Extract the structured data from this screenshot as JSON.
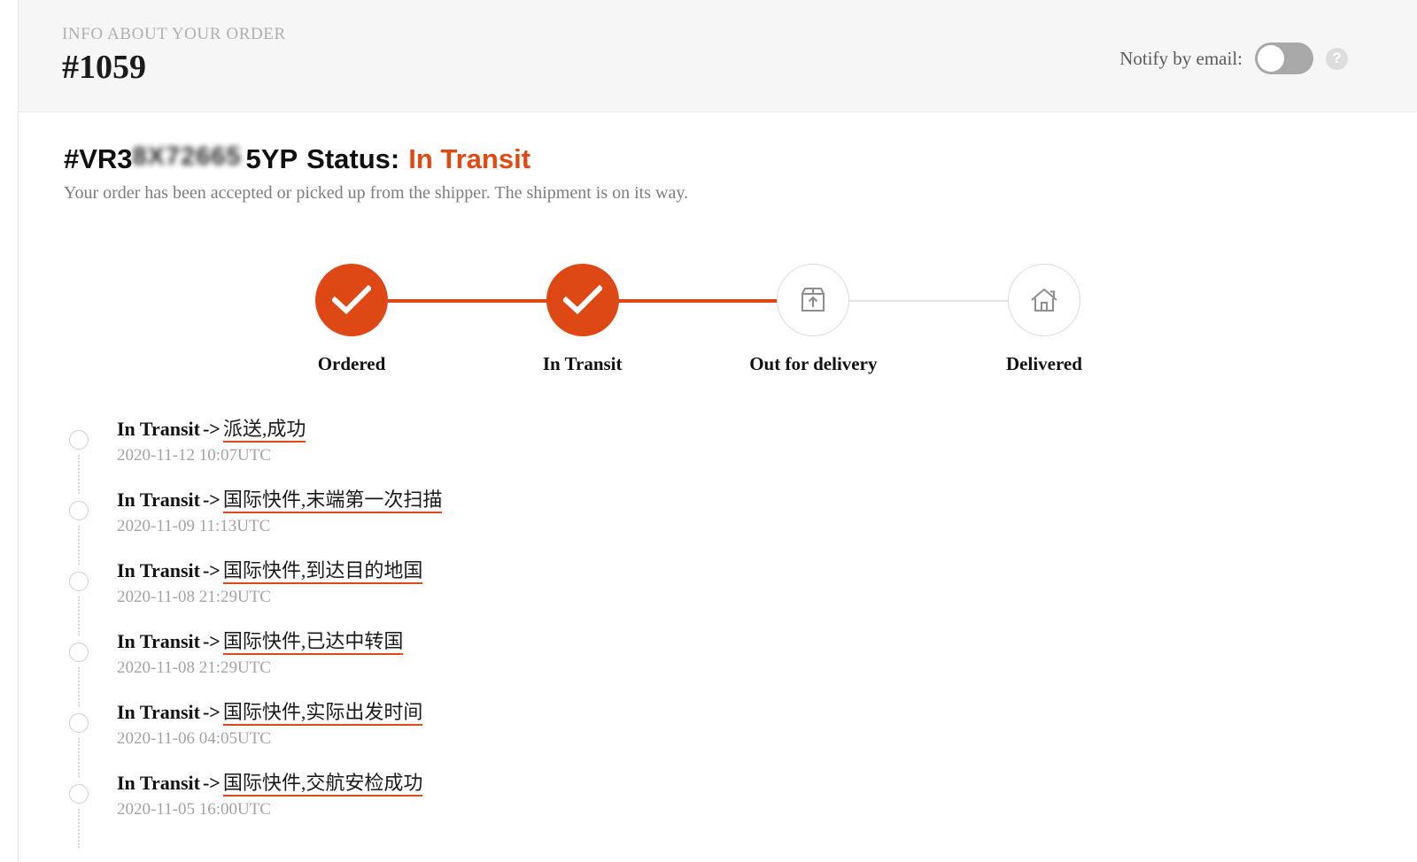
{
  "header": {
    "kicker": "INFO ABOUT YOUR ORDER",
    "order_number": "#1059",
    "notify_label": "Notify by email:",
    "notify_enabled": false,
    "help_glyph": "?"
  },
  "status": {
    "tracking_prefix": "#VR3",
    "tracking_redacted": "8X72665",
    "tracking_suffix": "5YP",
    "status_label": "Status:",
    "status_value": "In Transit",
    "status_color": "#e04912",
    "description": "Your order has been accepted or picked up from the shipper. The shipment is on its way."
  },
  "stepper": {
    "steps": [
      {
        "label": "Ordered",
        "state": "done",
        "icon": "check-icon"
      },
      {
        "label": "In Transit",
        "state": "done",
        "icon": "check-icon"
      },
      {
        "label": "Out for delivery",
        "state": "todo",
        "icon": "package-up-arrow-icon"
      },
      {
        "label": "Delivered",
        "state": "todo",
        "icon": "house-icon"
      }
    ],
    "connectors": [
      "done",
      "done",
      "todo"
    ],
    "active_color": "#dd4814",
    "inactive_color": "#e2e2e2"
  },
  "timeline": {
    "events": [
      {
        "status": "In Transit",
        "arrow": "->",
        "detail": "派送,成功",
        "time": "2020-11-12 10:07UTC"
      },
      {
        "status": "In Transit",
        "arrow": "->",
        "detail": "国际快件,末端第一次扫描",
        "time": "2020-11-09 11:13UTC"
      },
      {
        "status": "In Transit",
        "arrow": "->",
        "detail": "国际快件,到达目的地国",
        "time": "2020-11-08 21:29UTC"
      },
      {
        "status": "In Transit",
        "arrow": "->",
        "detail": "国际快件,已达中转国",
        "time": "2020-11-08 21:29UTC"
      },
      {
        "status": "In Transit",
        "arrow": "->",
        "detail": "国际快件,实际出发时间",
        "time": "2020-11-06 04:05UTC"
      },
      {
        "status": "In Transit",
        "arrow": "->",
        "detail": "国际快件,交航安检成功",
        "time": "2020-11-05 16:00UTC"
      }
    ]
  }
}
